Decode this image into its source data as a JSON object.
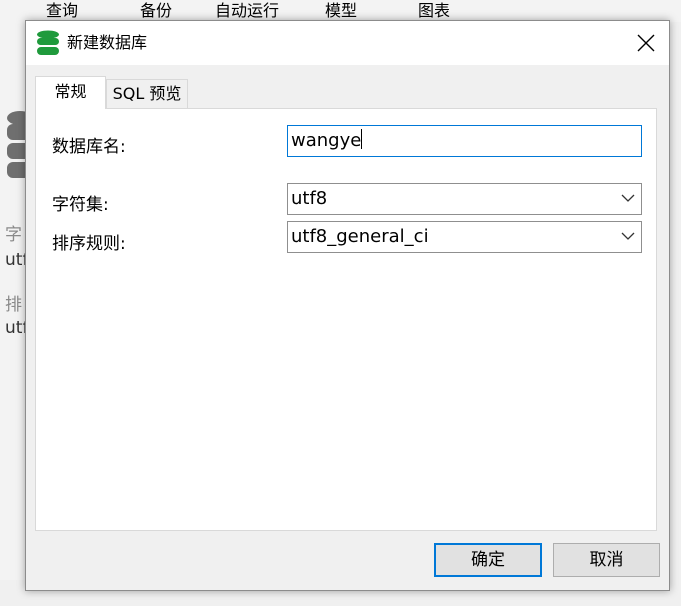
{
  "background": {
    "toolbar": [
      "查询",
      "备份",
      "自动运行",
      "模型",
      "图表"
    ],
    "side_fragments": [
      "字",
      "utf",
      "排",
      "utf"
    ]
  },
  "dialog": {
    "title": "新建数据库",
    "icon": "database-icon",
    "tabs": [
      "常规",
      "SQL 预览"
    ],
    "active_tab": "常规",
    "fields": {
      "db_name": {
        "label": "数据库名:",
        "value": "wangye"
      },
      "charset": {
        "label": "字符集:",
        "value": "utf8"
      },
      "collation": {
        "label": "排序规则:",
        "value": "utf8_general_ci"
      }
    },
    "buttons": {
      "ok": "确定",
      "cancel": "取消"
    }
  },
  "colors": {
    "accent": "#0078d7",
    "db_icon": "#1f9a3c",
    "bg_db_icon": "#6f6f6f"
  }
}
